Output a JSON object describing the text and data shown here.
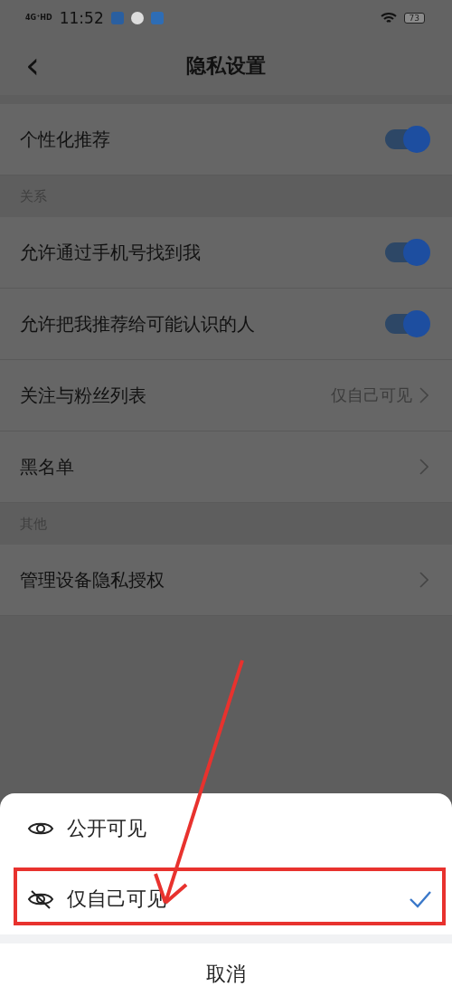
{
  "status_bar": {
    "network": "4G⁺HD",
    "time": "11:52",
    "battery": "73"
  },
  "header": {
    "title": "隐私设置",
    "back": "‹"
  },
  "sections": [
    {
      "rows": [
        {
          "kind": "toggle",
          "label": "个性化推荐",
          "on": true
        }
      ]
    },
    {
      "title": "关系",
      "rows": [
        {
          "kind": "toggle",
          "label": "允许通过手机号找到我",
          "on": true
        },
        {
          "kind": "toggle",
          "label": "允许把我推荐给可能认识的人",
          "on": true
        },
        {
          "kind": "link",
          "label": "关注与粉丝列表",
          "value": "仅自己可见"
        },
        {
          "kind": "link",
          "label": "黑名单"
        }
      ]
    },
    {
      "title": "其他",
      "rows": [
        {
          "kind": "link",
          "label": "管理设备隐私授权"
        }
      ]
    }
  ],
  "sheet": {
    "options": [
      {
        "kind": "public",
        "label": "公开可见",
        "selected": false
      },
      {
        "kind": "private",
        "label": "仅自己可见",
        "selected": true
      }
    ],
    "cancel": "取消"
  }
}
